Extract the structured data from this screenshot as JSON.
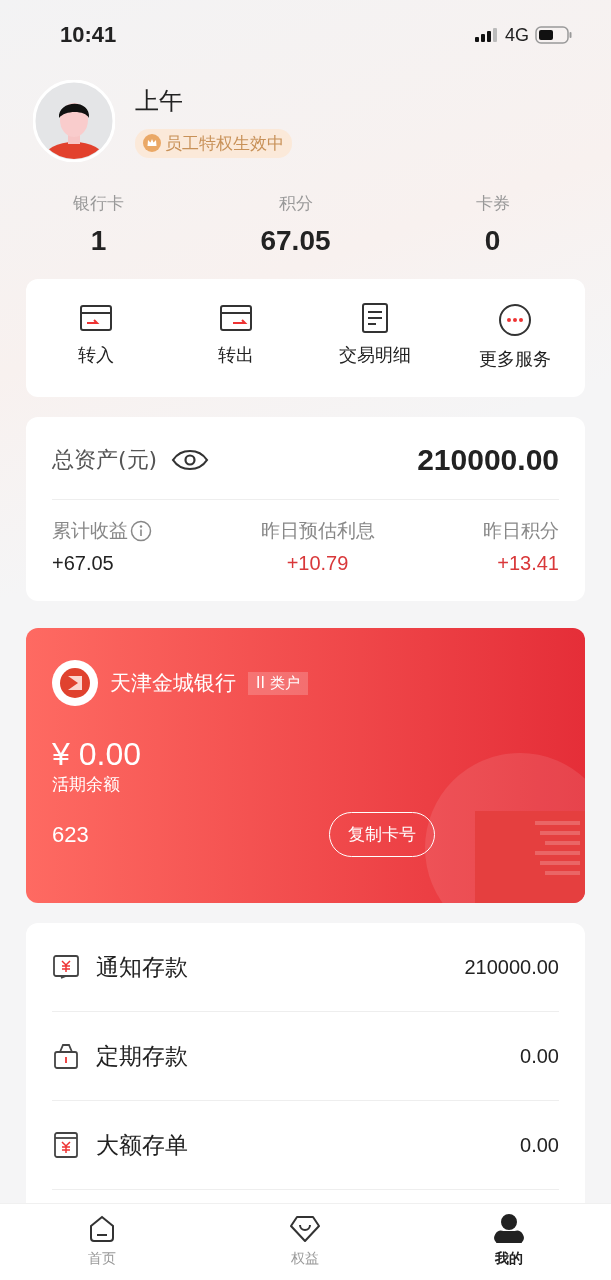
{
  "status_bar": {
    "time": "10:41",
    "network": "4G"
  },
  "profile": {
    "name": "上午",
    "badge": "员工特权生效中"
  },
  "stats": [
    {
      "label": "银行卡",
      "value": "1"
    },
    {
      "label": "积分",
      "value": "67.05"
    },
    {
      "label": "卡券",
      "value": "0"
    }
  ],
  "quick_actions": [
    {
      "label": "转入",
      "kind": "in"
    },
    {
      "label": "转出",
      "kind": "out"
    },
    {
      "label": "交易明细",
      "kind": "detail"
    },
    {
      "label": "更多服务",
      "kind": "more"
    }
  ],
  "assets": {
    "title": "总资产(元)",
    "total": "210000.00",
    "items": [
      {
        "label": "累计收益",
        "value": "+67.05",
        "info": true,
        "positive_red": false
      },
      {
        "label": "昨日预估利息",
        "value": "+10.79",
        "info": false,
        "positive_red": true
      },
      {
        "label": "昨日积分",
        "value": "+13.41",
        "info": false,
        "positive_red": true
      }
    ]
  },
  "bank_card": {
    "bank": "天津金城银行",
    "account_type": "II 类户",
    "balance": "¥ 0.00",
    "balance_label": "活期余额",
    "card_number": "623",
    "copy_button": "复制卡号"
  },
  "deposits": [
    {
      "name": "通知存款",
      "amount": "210000.00",
      "kind": "notice"
    },
    {
      "name": "定期存款",
      "amount": "0.00",
      "kind": "fixed"
    },
    {
      "name": "大额存单",
      "amount": "0.00",
      "kind": "cd"
    }
  ],
  "tabs": [
    {
      "label": "首页",
      "kind": "home",
      "selected": false
    },
    {
      "label": "权益",
      "kind": "rights",
      "selected": false
    },
    {
      "label": "我的",
      "kind": "me",
      "selected": true
    }
  ]
}
